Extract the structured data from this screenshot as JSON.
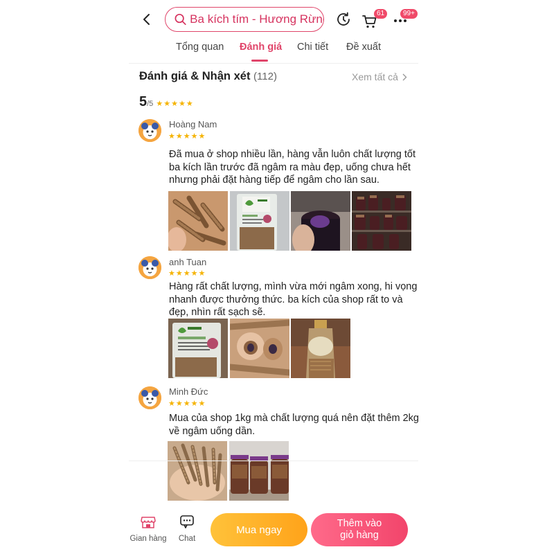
{
  "header": {
    "search_text": "Ba kích tím - Hương Rừng",
    "cart_badge": "61",
    "more_badge": "99+"
  },
  "tabs": [
    {
      "label": "Tổng quan",
      "active": false
    },
    {
      "label": "Đánh giá",
      "active": true
    },
    {
      "label": "Chi tiết",
      "active": false
    },
    {
      "label": "Đề xuất",
      "active": false
    }
  ],
  "ratings": {
    "title": "Đánh giá & Nhận xét",
    "count": "(112)",
    "see_all": "Xem tất cả",
    "score": "5",
    "out_of": "/5",
    "stars": 5
  },
  "reviews": [
    {
      "name": "Hoàng Nam",
      "stars": 5,
      "lines": [
        "Đã mua ở shop nhiều lần, hàng vẫn luôn chất lượng tốt",
        "ba kích lần trước đã ngâm ra màu đẹp, uống chưa hết",
        "nhưng phải đặt hàng tiếp để ngâm cho lần sau."
      ],
      "photo_count": 4
    },
    {
      "name": "anh Tuan",
      "stars": 5,
      "lines": [
        "Hàng rất chất lượng, mình vừa mới ngâm xong, hi vọng",
        "nhanh được thưởng thức. ba kích của shop rất to và",
        "đẹp, nhìn rất sạch sẽ."
      ],
      "photo_count": 3
    },
    {
      "name": "Minh Đức",
      "stars": 5,
      "lines": [
        "Mua của shop 1kg mà chất lượng quá nên đặt thêm 2kg",
        "về ngâm uống dần."
      ],
      "photo_count": 2
    }
  ],
  "bottom_bar": {
    "shop_label": "Gian hàng",
    "chat_label": "Chat",
    "buy_now": "Mua ngay",
    "add_to_cart_line1": "Thêm vào",
    "add_to_cart_line2": "giỏ hàng"
  },
  "colors": {
    "accent": "#e0456a",
    "star": "#f5b301",
    "buy_now": "#ffb22a",
    "add_to_cart": "#f2456b"
  }
}
